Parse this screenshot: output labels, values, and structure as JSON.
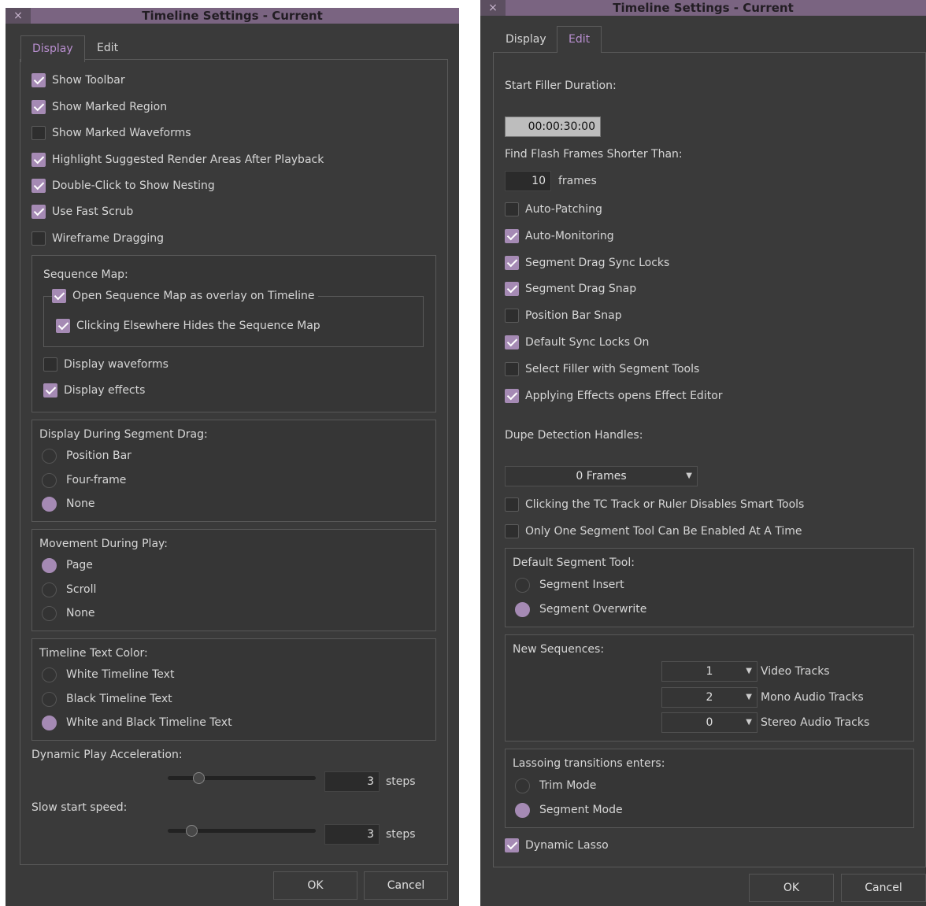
{
  "left": {
    "title": "Timeline Settings - Current",
    "close_icon": "×",
    "tabs": [
      {
        "label": "Display",
        "active": true
      },
      {
        "label": "Edit",
        "active": false
      }
    ],
    "checkboxes": [
      {
        "label": "Show Toolbar",
        "checked": true
      },
      {
        "label": "Show Marked Region",
        "checked": true
      },
      {
        "label": "Show Marked Waveforms",
        "checked": false
      },
      {
        "label": "Highlight Suggested Render Areas After Playback",
        "checked": true
      },
      {
        "label": "Double-Click to Show Nesting",
        "checked": true
      },
      {
        "label": "Use Fast Scrub",
        "checked": true
      },
      {
        "label": "Wireframe Dragging",
        "checked": false
      }
    ],
    "sequence_map": {
      "title": "Sequence Map:",
      "overlay": {
        "label": "Open Sequence Map as overlay on Timeline",
        "checked": true
      },
      "hides": {
        "label": "Clicking Elsewhere Hides the Sequence Map",
        "checked": true
      },
      "waveforms": {
        "label": "Display waveforms",
        "checked": false
      },
      "effects": {
        "label": "Display effects",
        "checked": true
      }
    },
    "segment_drag": {
      "title": "Display During Segment Drag:",
      "options": [
        {
          "label": "Position Bar",
          "selected": false
        },
        {
          "label": "Four-frame",
          "selected": false
        },
        {
          "label": "None",
          "selected": true
        }
      ]
    },
    "movement": {
      "title": "Movement During Play:",
      "options": [
        {
          "label": "Page",
          "selected": true
        },
        {
          "label": "Scroll",
          "selected": false
        },
        {
          "label": "None",
          "selected": false
        }
      ]
    },
    "text_color": {
      "title": "Timeline Text Color:",
      "options": [
        {
          "label": "White Timeline Text",
          "selected": false
        },
        {
          "label": "Black Timeline Text",
          "selected": false
        },
        {
          "label": "White and Black Timeline Text",
          "selected": true
        }
      ]
    },
    "dynamic_play": {
      "label": "Dynamic Play Acceleration:",
      "value": "3",
      "unit": "steps"
    },
    "slow_start": {
      "label": "Slow start speed:",
      "value": "3",
      "unit": "steps"
    },
    "ok": "OK",
    "cancel": "Cancel",
    "colors": {
      "accent": "#a58ab4",
      "titlebar": "#7a6481",
      "background": "#3a3a3a"
    }
  },
  "right": {
    "title": "Timeline Settings - Current",
    "close_icon": "×",
    "tabs": [
      {
        "label": "Display",
        "active": false
      },
      {
        "label": "Edit",
        "active": true
      }
    ],
    "start_filler": {
      "label": "Start Filler Duration:",
      "value": "00:00:30:00"
    },
    "flash_frames": {
      "label": "Find Flash Frames Shorter Than:",
      "value": "10",
      "unit": "frames"
    },
    "checkboxes": [
      {
        "label": "Auto-Patching",
        "checked": false
      },
      {
        "label": "Auto-Monitoring",
        "checked": true
      },
      {
        "label": "Segment Drag Sync Locks",
        "checked": true
      },
      {
        "label": "Segment Drag Snap",
        "checked": true
      },
      {
        "label": "Position Bar Snap",
        "checked": false
      },
      {
        "label": "Default Sync Locks On",
        "checked": true
      },
      {
        "label": "Select Filler with Segment Tools",
        "checked": false
      },
      {
        "label": "Applying Effects opens Effect Editor",
        "checked": true
      }
    ],
    "dupe": {
      "label": "Dupe Detection Handles:",
      "value": "0 Frames"
    },
    "smart_tools": {
      "label": "Clicking the TC Track or Ruler Disables Smart Tools",
      "checked": false
    },
    "one_segment": {
      "label": "Only One Segment Tool Can Be Enabled At A Time",
      "checked": false
    },
    "default_tool": {
      "title": "Default Segment Tool:",
      "options": [
        {
          "label": "Segment Insert",
          "selected": false
        },
        {
          "label": "Segment Overwrite",
          "selected": true
        }
      ]
    },
    "new_sequences": {
      "title": "New Sequences:",
      "rows": [
        {
          "value": "1",
          "label": "Video Tracks"
        },
        {
          "value": "2",
          "label": "Mono Audio Tracks"
        },
        {
          "value": "0",
          "label": "Stereo Audio Tracks"
        }
      ]
    },
    "lasso": {
      "title": "Lassoing transitions enters:",
      "options": [
        {
          "label": "Trim Mode",
          "selected": false
        },
        {
          "label": "Segment Mode",
          "selected": true
        }
      ]
    },
    "dynamic_lasso": {
      "label": "Dynamic Lasso",
      "checked": true
    },
    "ok": "OK",
    "cancel": "Cancel"
  }
}
